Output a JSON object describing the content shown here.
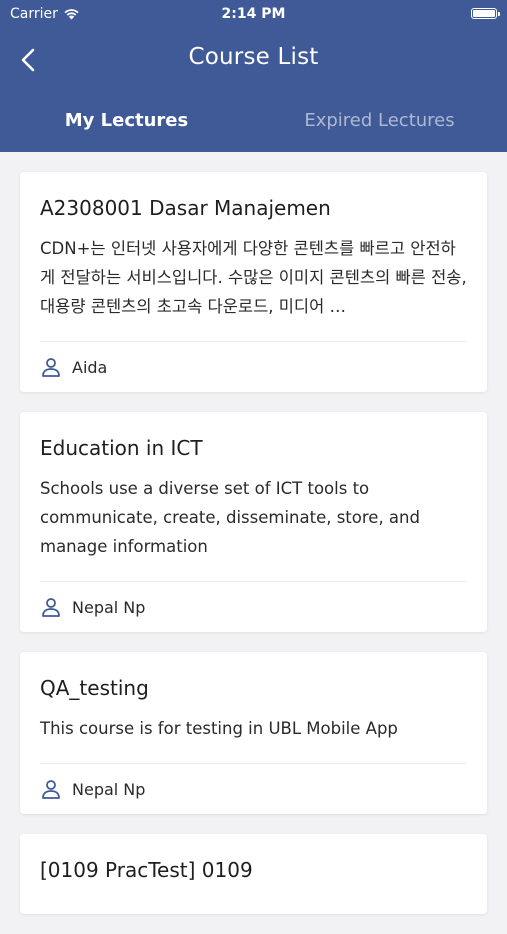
{
  "status_bar": {
    "carrier": "Carrier",
    "time": "2:14 PM"
  },
  "header": {
    "title": "Course List",
    "tabs": [
      {
        "label": "My Lectures",
        "active": true
      },
      {
        "label": "Expired Lectures",
        "active": false
      }
    ]
  },
  "courses": [
    {
      "title": "A2308001 Dasar Manajemen",
      "description": "CDN+는 인터넷 사용자에게 다양한 콘텐츠를 빠르고 안전하게 전달하는 서비스입니다. 수많은 이미지 콘텐츠의 빠른 전송, 대용량 콘텐츠의 초고속 다운로드, 미디어 …",
      "author": "Aida"
    },
    {
      "title": "Education in ICT",
      "description": "Schools use a diverse set of ICT tools to communicate, create, disseminate, store, and manage information",
      "author": "Nepal Np"
    },
    {
      "title": "QA_testing",
      "description": "This course is for testing in UBL Mobile App",
      "author": "Nepal Np"
    },
    {
      "title": "[0109 PracTest] 0109"
    }
  ],
  "colors": {
    "header_bg": "#3f5a97",
    "inactive_tab": "#aeb8d3",
    "author_icon": "#3f5a97"
  }
}
